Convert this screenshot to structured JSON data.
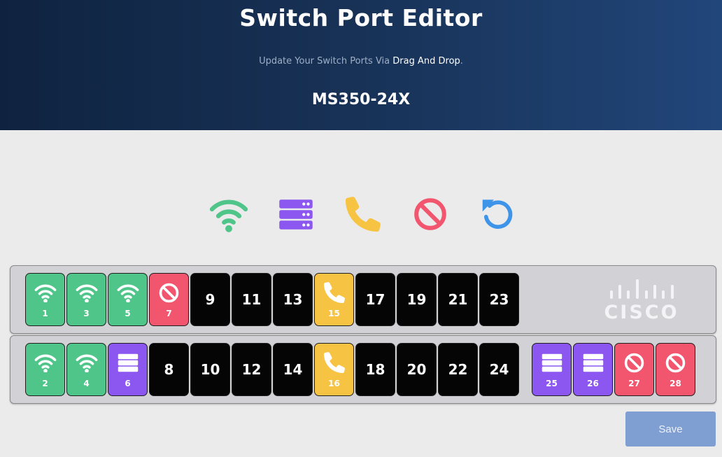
{
  "header": {
    "title": "Switch Port Editor",
    "subtitle_prefix": "Update Your Switch Ports Via ",
    "subtitle_highlight": "Drag And Drop",
    "subtitle_suffix": ".",
    "model": "MS350-24X"
  },
  "palette": [
    {
      "type": "wifi",
      "icon": "wifi-icon",
      "color": "#4fc58a"
    },
    {
      "type": "server",
      "icon": "server-icon",
      "color": "#8b57f0"
    },
    {
      "type": "phone",
      "icon": "phone-icon",
      "color": "#f7c342"
    },
    {
      "type": "block",
      "icon": "block-icon",
      "color": "#f2556e"
    },
    {
      "type": "reset",
      "icon": "undo-icon",
      "color": "#3d94e8"
    }
  ],
  "rows": [
    [
      {
        "num": "1",
        "type": "wifi"
      },
      {
        "num": "3",
        "type": "wifi"
      },
      {
        "num": "5",
        "type": "wifi"
      },
      {
        "num": "7",
        "type": "block"
      },
      {
        "num": "9",
        "type": "empty"
      },
      {
        "num": "11",
        "type": "empty"
      },
      {
        "num": "13",
        "type": "empty"
      },
      {
        "num": "15",
        "type": "phone"
      },
      {
        "num": "17",
        "type": "empty"
      },
      {
        "num": "19",
        "type": "empty"
      },
      {
        "num": "21",
        "type": "empty"
      },
      {
        "num": "23",
        "type": "empty"
      }
    ],
    [
      {
        "num": "2",
        "type": "wifi"
      },
      {
        "num": "4",
        "type": "wifi"
      },
      {
        "num": "6",
        "type": "server"
      },
      {
        "num": "8",
        "type": "empty"
      },
      {
        "num": "10",
        "type": "empty"
      },
      {
        "num": "12",
        "type": "empty"
      },
      {
        "num": "14",
        "type": "empty"
      },
      {
        "num": "16",
        "type": "phone"
      },
      {
        "num": "18",
        "type": "empty"
      },
      {
        "num": "20",
        "type": "empty"
      },
      {
        "num": "22",
        "type": "empty"
      },
      {
        "num": "24",
        "type": "empty"
      },
      {
        "num": "25",
        "type": "server"
      },
      {
        "num": "26",
        "type": "server"
      },
      {
        "num": "27",
        "type": "block"
      },
      {
        "num": "28",
        "type": "block"
      }
    ]
  ],
  "logo": {
    "text": "CISCO",
    "icon": "cisco-logo"
  },
  "save_label": "Save",
  "colors": {
    "wifi": "#4fc58a",
    "server": "#8b57f0",
    "phone": "#f7c342",
    "block": "#f2556e",
    "reset": "#3d94e8",
    "empty": "#050505",
    "save": "#7f9ed1"
  }
}
